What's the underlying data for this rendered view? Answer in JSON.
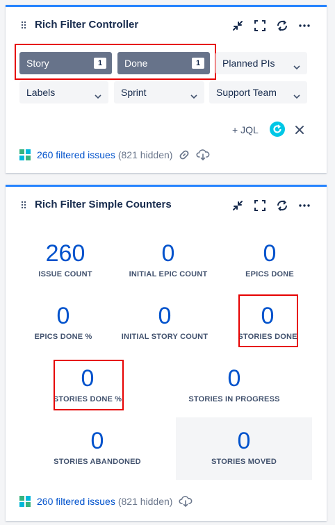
{
  "controller": {
    "title": "Rich Filter Controller",
    "active_filters": [
      {
        "label": "Story",
        "count": "1"
      },
      {
        "label": "Done",
        "count": "1"
      }
    ],
    "dropdowns": {
      "planned": "Planned PIs",
      "labels": "Labels",
      "sprint": "Sprint",
      "support": "Support Team"
    },
    "jql_label": "+ JQL",
    "footer": {
      "link": "260 filtered issues",
      "hidden": "(821 hidden)"
    }
  },
  "counters_gadget": {
    "title": "Rich Filter Simple Counters",
    "counters": [
      {
        "value": "260",
        "label": "ISSUE COUNT"
      },
      {
        "value": "0",
        "label": "INITIAL EPIC COUNT"
      },
      {
        "value": "0",
        "label": "EPICS DONE"
      },
      {
        "value": "0",
        "label": "EPICS DONE %"
      },
      {
        "value": "0",
        "label": "INITIAL STORY COUNT"
      },
      {
        "value": "0",
        "label": "STORIES DONE"
      },
      {
        "value": "0",
        "label": "STORIES DONE %"
      },
      {
        "value": "0",
        "label": "STORIES IN PROGRESS"
      },
      {
        "value": "0",
        "label": "STORIES ABANDONED"
      },
      {
        "value": "0",
        "label": "STORIES MOVED"
      }
    ],
    "footer": {
      "link": "260 filtered issues",
      "hidden": "(821 hidden)"
    }
  },
  "icons": [
    "drag-handle-icon",
    "collapse-icon",
    "fullscreen-icon",
    "refresh-icon",
    "more-icon",
    "chevron-down-icon",
    "refresh-circle-icon",
    "close-icon",
    "grid-icon",
    "link-icon",
    "cloud-download-icon"
  ],
  "colors": {
    "accent": "#2684ff",
    "link": "#0052cc",
    "chip_active": "#67738a",
    "highlight": "#e60000",
    "refresh": "#00c7e6"
  }
}
